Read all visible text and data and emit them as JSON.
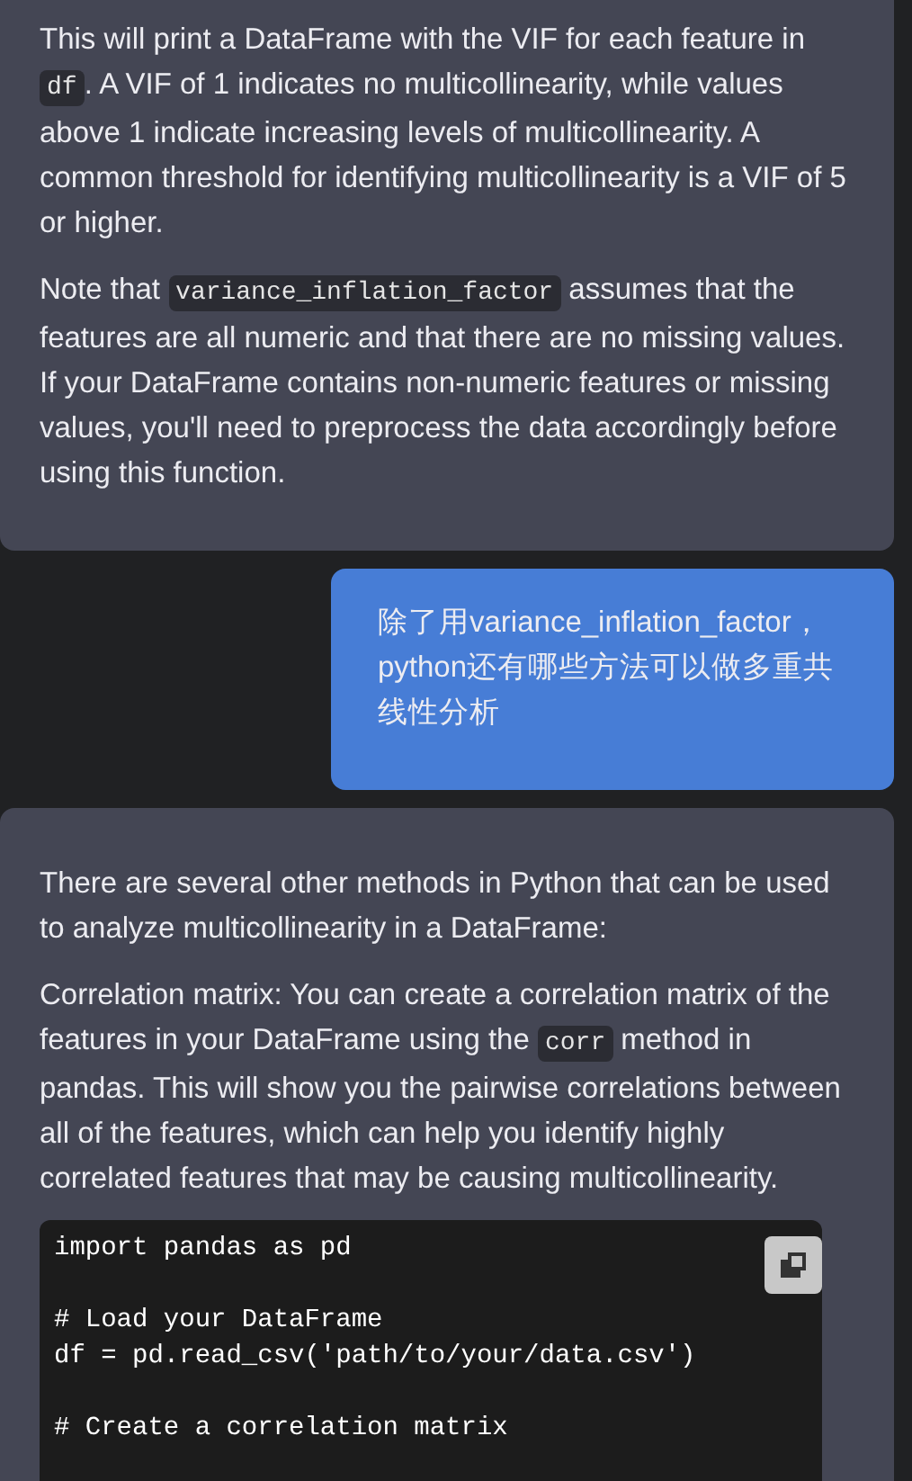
{
  "messages": [
    {
      "kind": "assistant",
      "paragraphs": [
        [
          {
            "kind": "text",
            "text": "This will print a DataFrame with the VIF for each feature in "
          },
          {
            "kind": "code",
            "text": "df"
          },
          {
            "kind": "text",
            "text": ". A VIF of 1 indicates no multicollinearity, while values above 1 indicate increasing levels of multicollinearity. A common threshold for identifying multicollinearity is a VIF of 5 or higher."
          }
        ],
        [
          {
            "kind": "text",
            "text": "Note that "
          },
          {
            "kind": "code",
            "text": "variance_inflation_factor"
          },
          {
            "kind": "text",
            "text": " assumes that the features are all numeric and that there are no missing values. If your DataFrame contains non-numeric features or missing values, you'll need to preprocess the data accordingly before using this function."
          }
        ]
      ]
    },
    {
      "kind": "user",
      "text": "除了用variance_inflation_factor，python还有哪些方法可以做多重共线性分析"
    },
    {
      "kind": "assistant",
      "paragraphs": [
        [
          {
            "kind": "text",
            "text": "There are several other methods in Python that can be used to analyze multicollinearity in a DataFrame:"
          }
        ],
        [
          {
            "kind": "text",
            "text": "Correlation matrix: You can create a correlation matrix of the features in your DataFrame using the "
          },
          {
            "kind": "code",
            "text": "corr"
          },
          {
            "kind": "text",
            "text": " method in pandas. This will show you the pairwise correlations between all of the features, which can help you identify highly correlated features that may be causing multicollinearity."
          }
        ]
      ],
      "code_block": {
        "code": "import pandas as pd\n\n# Load your DataFrame\ndf = pd.read_csv('path/to/your/data.csv')\n\n# Create a correlation matrix"
      }
    }
  ]
}
